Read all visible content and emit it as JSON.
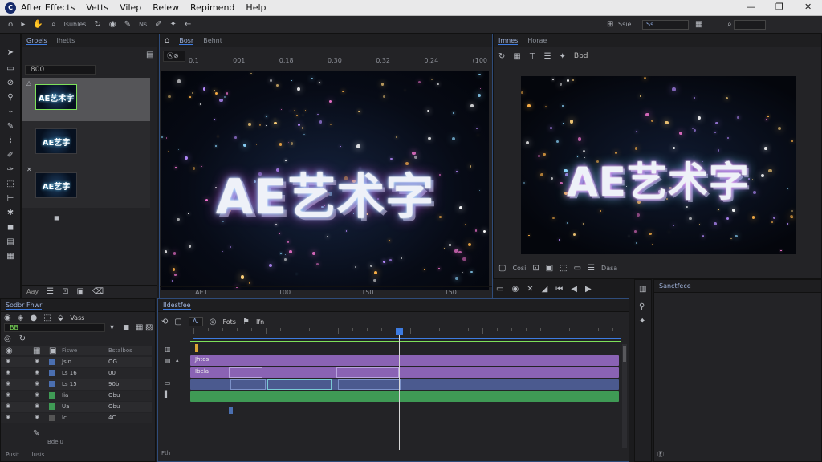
{
  "menubar": {
    "items": [
      "After Effects",
      "Vetts",
      "Vilep",
      "Relew",
      "Repimend",
      "Help"
    ],
    "window_controls": [
      "—",
      "❐",
      "✕"
    ]
  },
  "toolbar": {
    "labels": [
      "Isuhles",
      "Ns",
      "Ssie"
    ],
    "dropdown_value": "Ss"
  },
  "project": {
    "tabs": [
      "Groels",
      "Ihetts"
    ],
    "search_value": "800",
    "thumbnails": [
      "AE艺术字",
      "AE艺字",
      "AE艺字"
    ],
    "footer": [
      "Aay"
    ]
  },
  "viewer": {
    "tabs": [
      "Bosr",
      "Behnt"
    ],
    "ruler_labels": [
      "0.1",
      "001",
      "0.18",
      "0.30",
      "0.32",
      "0.24",
      "(100"
    ],
    "title_text": "AE艺术字",
    "bottom_labels": [
      "AE1",
      "100",
      "150",
      "150"
    ]
  },
  "preview": {
    "tabs": [
      "Imnes",
      "Horae"
    ],
    "label": "Bbd",
    "title_text": "AE艺术字",
    "controls": [
      "Cosi",
      "Dasa"
    ]
  },
  "effects": {
    "tab": "Sanctfece"
  },
  "layers": {
    "tabs": [
      "Sodbr Fhwr"
    ],
    "active_label": "Vass",
    "search_value": "BB",
    "columns": [
      "Fiswe",
      "Bstalbos"
    ],
    "rows": [
      {
        "name": "Jsin",
        "value": "OG"
      },
      {
        "name": "Ls 16",
        "value": "00"
      },
      {
        "name": "Ls 15",
        "value": "90b"
      },
      {
        "name": "Iia",
        "value": "Obu"
      },
      {
        "name": "Ua",
        "value": "Obu"
      },
      {
        "name": "Ic",
        "value": "4C"
      }
    ],
    "footer": [
      "Pusif",
      "Iusis"
    ],
    "sub_label": "Bdelu"
  },
  "timeline": {
    "tab": "Ildestfee",
    "toolbar_labels": [
      "Fots",
      "Ifn"
    ],
    "tracks": [
      {
        "label": "Jhtos"
      },
      {
        "label": "Ibela"
      },
      {
        "label": ""
      },
      {
        "label": ""
      }
    ],
    "footer": "Fth"
  },
  "colors": {
    "accent": "#3d7be0",
    "track_purple": "#8a63b4",
    "track_blue": "#4b5a8f",
    "track_green": "#3f9a55",
    "active_highlight": "#7ee25a"
  }
}
